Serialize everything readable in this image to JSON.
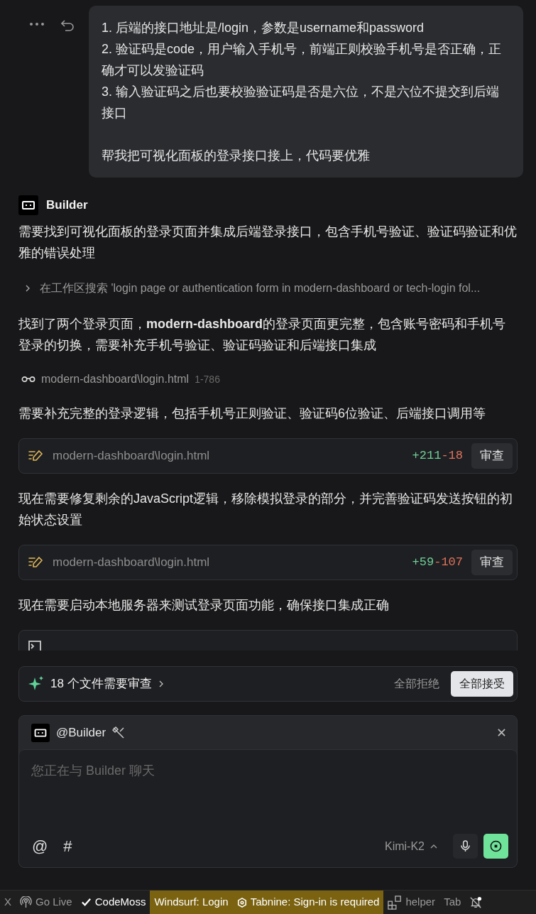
{
  "user_message": {
    "paragraphs": [
      [
        "1. 后端的接口地址是/login，参数是username和password",
        "2. 验证码是code，用户输入手机号，前端正则校验手机号是否正确，正确才可以发验证码",
        "3. 输入验证码之后也要校验验证码是否是六位，不是六位不提交到后端接口"
      ],
      [
        "帮我把可视化面板的登录接口接上，代码要优雅"
      ]
    ]
  },
  "assistant": {
    "name": "Builder"
  },
  "steps": [
    {
      "kind": "text",
      "text": "需要找到可视化面板的登录页面并集成后端登录接口，包含手机号验证、验证码验证和优雅的错误处理"
    },
    {
      "kind": "search",
      "text": "在工作区搜索 'login page or authentication form in modern-dashboard or tech-login fol..."
    },
    {
      "kind": "text",
      "text": "找到了两个登录页面，**modern-dashboard**的登录页面更完整，包含账号密码和手机号登录的切换，需要补充手机号验证、验证码验证和后端接口集成"
    },
    {
      "kind": "read",
      "file": "modern-dashboard\\login.html",
      "range": "1-786"
    },
    {
      "kind": "text",
      "text": "需要补充完整的登录逻辑，包括手机号正则验证、验证码6位验证、后端接口调用等"
    },
    {
      "kind": "edit",
      "file": "modern-dashboard\\login.html",
      "added": "+211",
      "removed": "-18",
      "button": "审查"
    },
    {
      "kind": "text",
      "text": "现在需要修复剩余的JavaScript逻辑，移除模拟登录的部分，并完善验证码发送按钮的初始状态设置"
    },
    {
      "kind": "edit",
      "file": "modern-dashboard\\login.html",
      "added": "+59",
      "removed": "-107",
      "button": "审查"
    },
    {
      "kind": "text",
      "text": "现在需要启动本地服务器来测试登录页面功能，确保接口集成正确"
    },
    {
      "kind": "terminal"
    }
  ],
  "review_bar": {
    "label": "18 个文件需要审查",
    "reject": "全部拒绝",
    "accept": "全部接受"
  },
  "composer": {
    "mention": "@Builder",
    "placeholder": "您正在与 Builder 聊天",
    "tools": [
      "@",
      "#"
    ],
    "model": "Kimi-K2"
  },
  "status_bar": [
    {
      "kind": "plain",
      "label": "X",
      "highlighted": false
    },
    {
      "kind": "broadcast",
      "label": "Go Live",
      "highlighted": false
    },
    {
      "kind": "check",
      "label": "CodeMoss",
      "highlighted": false
    },
    {
      "kind": "plain",
      "label": "Windsurf: Login",
      "highlighted": true
    },
    {
      "kind": "hexagon",
      "label": "Tabnine: Sign-in is required",
      "highlighted": true
    },
    {
      "kind": "layout",
      "label": "helper",
      "highlighted": false
    },
    {
      "kind": "plain",
      "label": "Tab",
      "highlighted": false
    },
    {
      "kind": "bell_off",
      "highlighted": false
    }
  ]
}
